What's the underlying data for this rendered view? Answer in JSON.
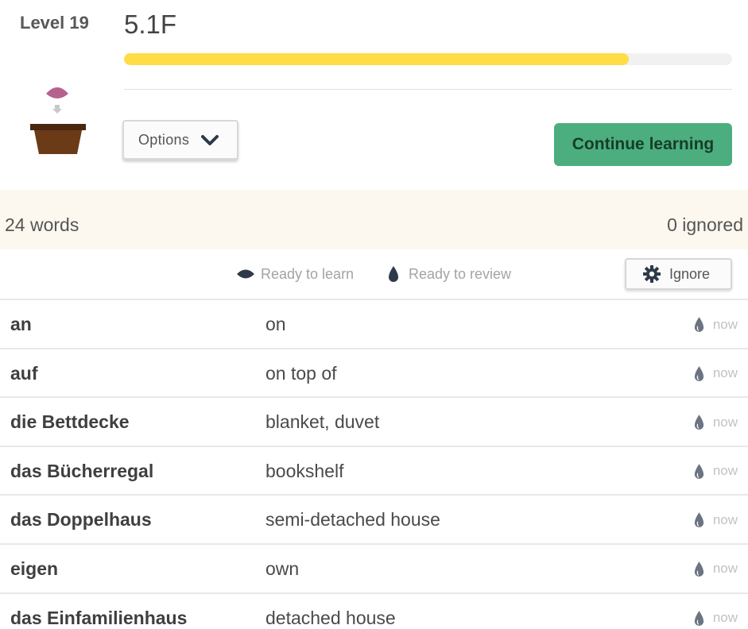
{
  "header": {
    "level_label": "Level 19",
    "level_title": "5.1F",
    "progress": 0.83,
    "colors": {
      "progress": "#fedd46",
      "continue": "#4cae7e",
      "plant_seed": "#b5628f",
      "pot": "#6b3a16"
    }
  },
  "buttons": {
    "options_label": "Options",
    "continue_label": "Continue learning",
    "ignore_label": "Ignore"
  },
  "summary": {
    "words": "24 words",
    "ignored": "0 ignored"
  },
  "legend": {
    "ready_to_learn": "Ready to learn",
    "ready_to_review": "Ready to review"
  },
  "words": [
    {
      "word": "an",
      "meaning": "on",
      "due": "now"
    },
    {
      "word": "auf",
      "meaning": "on top of",
      "due": "now"
    },
    {
      "word": "die Bettdecke",
      "meaning": "blanket, duvet",
      "due": "now"
    },
    {
      "word": "das Bücherregal",
      "meaning": "bookshelf",
      "due": "now"
    },
    {
      "word": "das Doppelhaus",
      "meaning": "semi-detached house",
      "due": "now"
    },
    {
      "word": "eigen",
      "meaning": "own",
      "due": "now"
    },
    {
      "word": "das Einfamilienhaus",
      "meaning": "detached house",
      "due": "now"
    }
  ],
  "icons": {
    "plant": "seed-pot-icon",
    "options": "chevron-down-icon",
    "learn": "seed-icon",
    "review": "water-drop-icon",
    "ignore": "gear-icon"
  }
}
